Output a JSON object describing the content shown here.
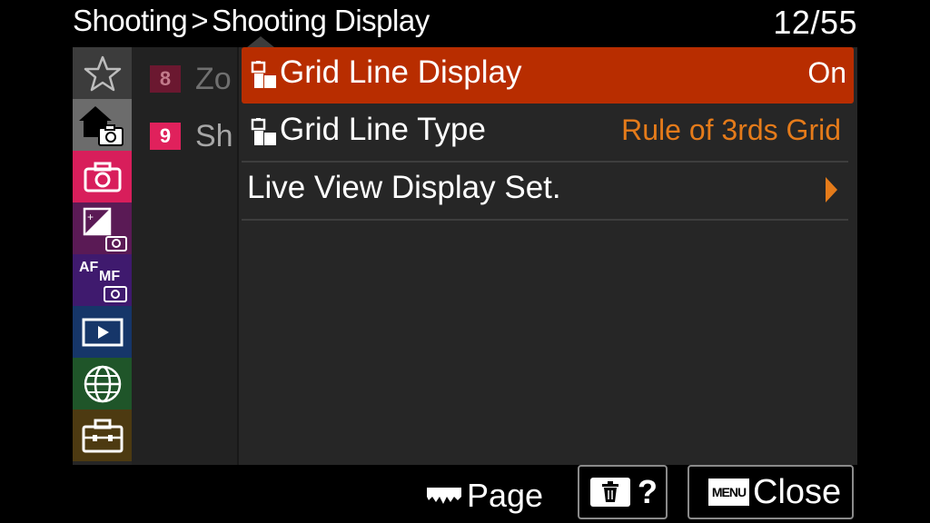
{
  "header": {
    "breadcrumb_parent": "Shooting",
    "breadcrumb_separator": ">",
    "breadcrumb_current": "Shooting Display",
    "page_count": "12/55"
  },
  "tabs": [
    {
      "name": "favorites",
      "icon": "star-icon"
    },
    {
      "name": "main",
      "icon": "home-camera-icon",
      "selected": true
    },
    {
      "name": "shooting",
      "icon": "camera-icon"
    },
    {
      "name": "exposure-color",
      "icon": "exposure-comp-icon"
    },
    {
      "name": "focus",
      "icon": "af-mf-icon",
      "text": "AF MF"
    },
    {
      "name": "playback",
      "icon": "play-icon"
    },
    {
      "name": "network",
      "icon": "globe-icon"
    },
    {
      "name": "setup",
      "icon": "toolbox-icon"
    }
  ],
  "groups": [
    {
      "number": "8",
      "text": "Zo"
    },
    {
      "number": "9",
      "text": "Sh"
    }
  ],
  "items": [
    {
      "label": "Grid Line Display",
      "value": "On",
      "icon": "still-movie-icon",
      "selected": true
    },
    {
      "label": "Grid Line Type",
      "value": "Rule of 3rds Grid",
      "icon": "still-movie-icon"
    },
    {
      "label": "Live View Display Set.",
      "value": "",
      "icon": "submenu-arrow-icon"
    }
  ],
  "footer": {
    "page_label": "Page",
    "help_label": "?",
    "menu_key": "MENU",
    "close_label": "Close"
  },
  "colors": {
    "selected_bg": "#b82d00",
    "value_orange": "#e57b1a",
    "panel_bg": "#262626",
    "shooting_tab": "#d81e5b"
  }
}
